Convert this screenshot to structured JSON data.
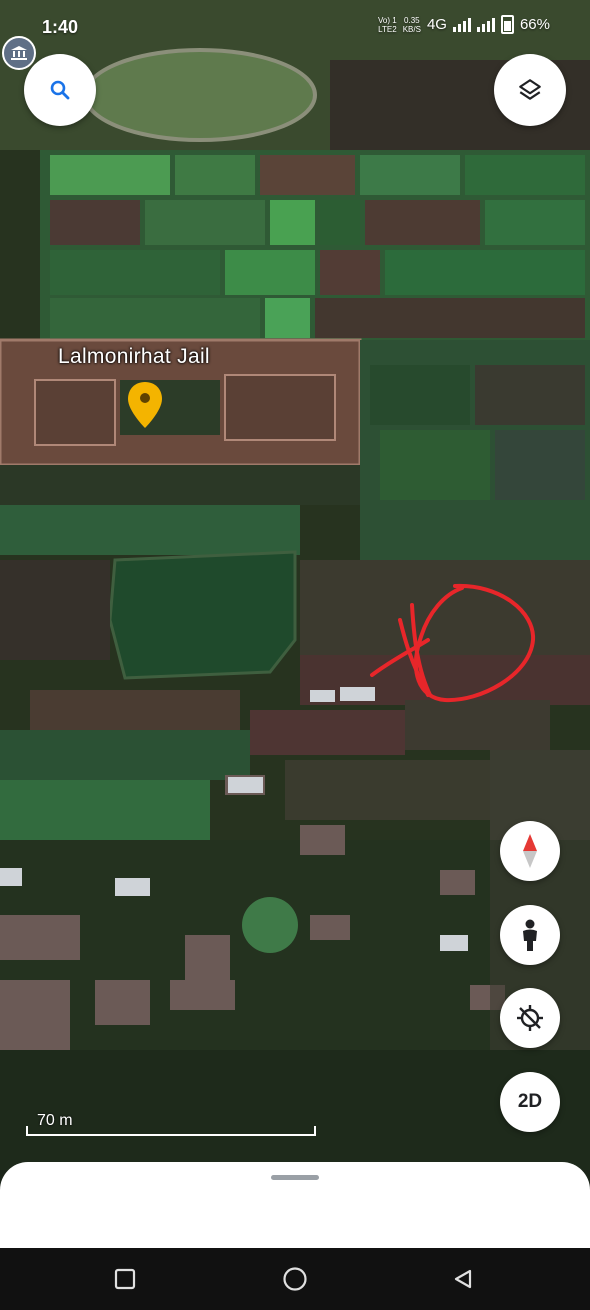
{
  "status_bar": {
    "time": "1:40",
    "volte_line1": "Vo) 1",
    "volte_line2": "LTE2",
    "speed_value": "0.35",
    "speed_unit": "KB/S",
    "network": "4G",
    "battery": "66%"
  },
  "map": {
    "place_label": "Lalmonirhat Jail",
    "scale_label": "70 m",
    "mode_button_label": "2D",
    "view_type": "satellite",
    "annotation_color": "#e8262a",
    "pin_color": "#f4b400"
  },
  "controls": {
    "search_icon": "search-icon",
    "layers_icon": "layers-icon",
    "compass_icon": "compass-icon",
    "street_view_icon": "pegman-icon",
    "location_icon": "location-off-icon"
  }
}
